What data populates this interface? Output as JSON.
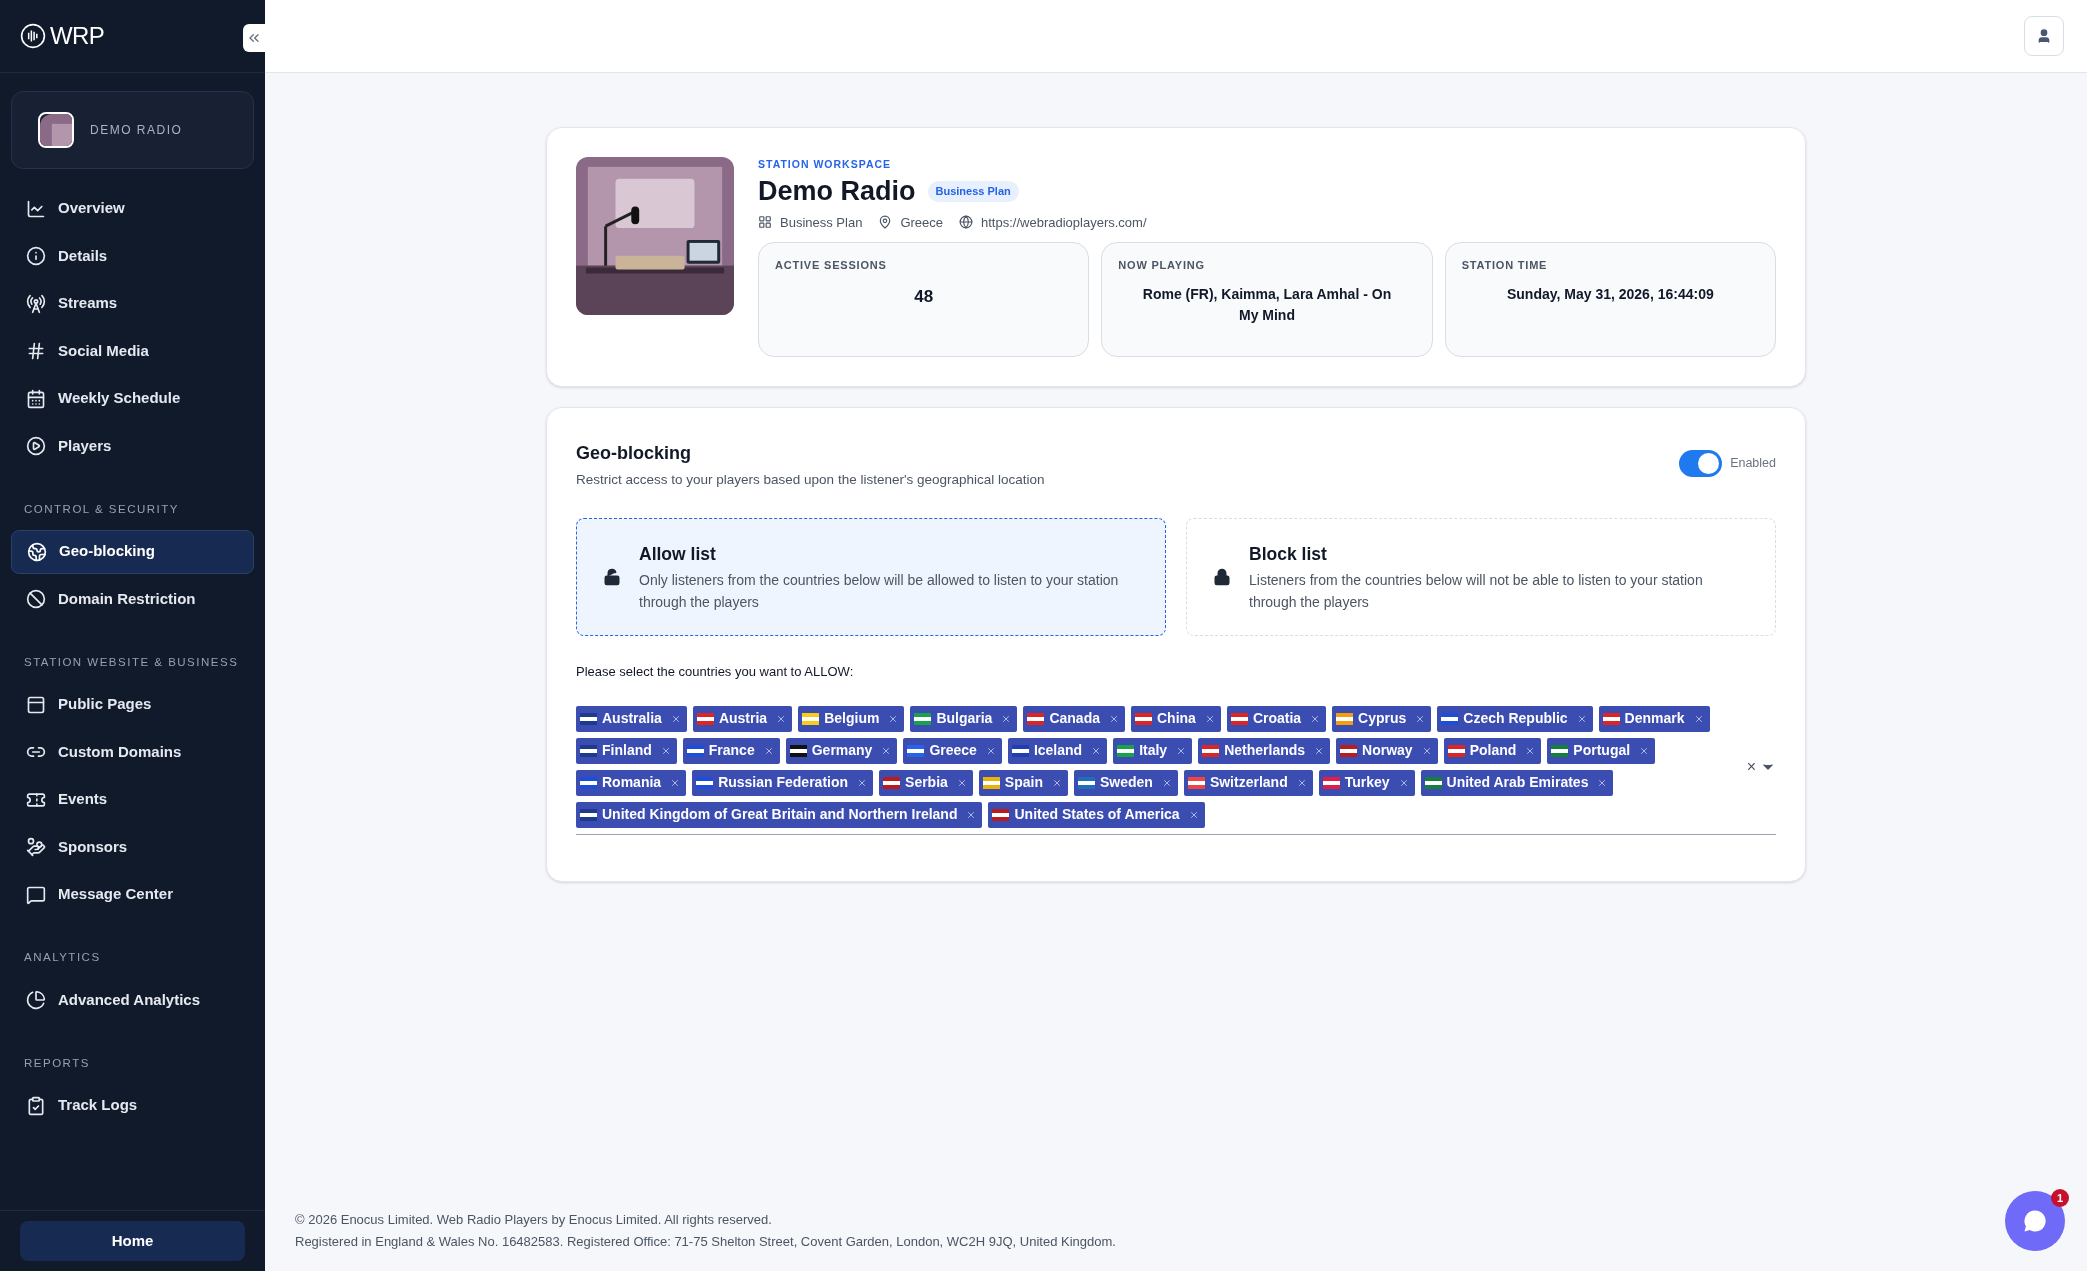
{
  "sidebar": {
    "logo": "WRP",
    "station": "DEMO RADIO",
    "sections": [
      {
        "items": [
          {
            "label": "Overview",
            "selected": false
          },
          {
            "label": "Details",
            "selected": false
          },
          {
            "label": "Streams",
            "selected": false
          },
          {
            "label": "Social Media",
            "selected": false
          },
          {
            "label": "Weekly Schedule",
            "selected": false
          },
          {
            "label": "Players",
            "selected": false
          }
        ]
      },
      {
        "title": "CONTROL & SECURITY",
        "items": [
          {
            "label": "Geo-blocking",
            "selected": true
          },
          {
            "label": "Domain Restriction",
            "selected": false
          }
        ]
      },
      {
        "title": "STATION WEBSITE & BUSINESS",
        "items": [
          {
            "label": "Public Pages",
            "selected": false
          },
          {
            "label": "Custom Domains",
            "selected": false
          },
          {
            "label": "Events",
            "selected": false
          },
          {
            "label": "Sponsors",
            "selected": false
          },
          {
            "label": "Message Center",
            "selected": false
          }
        ]
      },
      {
        "title": "ANALYTICS",
        "items": [
          {
            "label": "Advanced Analytics",
            "selected": false
          }
        ]
      },
      {
        "title": "REPORTS",
        "items": [
          {
            "label": "Track Logs",
            "selected": false
          }
        ]
      }
    ],
    "home_button": "Home"
  },
  "station": {
    "eyebrow": "STATION WORKSPACE",
    "name": "Demo Radio",
    "plan_badge": "Business Plan",
    "meta": [
      "Business Plan",
      "Greece",
      "https://webradioplayers.com/"
    ],
    "stats": [
      {
        "label": "ACTIVE SESSIONS",
        "value": "48"
      },
      {
        "label": "NOW PLAYING",
        "value": "Rome (FR), Kaimma, Lara Amhal - On My Mind"
      },
      {
        "label": "STATION TIME",
        "value": "Sunday, May 31, 2026, 16:44:09"
      }
    ]
  },
  "geo": {
    "title": "Geo-blocking",
    "subtitle": "Restrict access to your players based upon the listener's geographical location",
    "toggle": {
      "on": true,
      "label": "Enabled"
    },
    "modes": [
      {
        "title": "Allow list",
        "text": "Only listeners from the countries below will be allowed to listen to your station through the players",
        "selected": true,
        "locked": false
      },
      {
        "title": "Block list",
        "text": "Listeners from the countries below will not be able to listen to your station through the players",
        "selected": false,
        "locked": true
      }
    ],
    "prompt": "Please select the countries you want to ALLOW:",
    "countries": [
      {
        "name": "Australia",
        "color": "#1e3a8a"
      },
      {
        "name": "Austria",
        "color": "#dc2626"
      },
      {
        "name": "Belgium",
        "color": "#facc15"
      },
      {
        "name": "Bulgaria",
        "color": "#16a34a"
      },
      {
        "name": "Canada",
        "color": "#dc2626"
      },
      {
        "name": "China",
        "color": "#dc2626"
      },
      {
        "name": "Croatia",
        "color": "#dc2626"
      },
      {
        "name": "Cyprus",
        "color": "#f59e0b"
      },
      {
        "name": "Czech Republic",
        "color": "#1d4ed8"
      },
      {
        "name": "Denmark",
        "color": "#dc2626"
      },
      {
        "name": "Finland",
        "color": "#1e3a8a"
      },
      {
        "name": "France",
        "color": "#1d4ed8"
      },
      {
        "name": "Germany",
        "color": "#111111"
      },
      {
        "name": "Greece",
        "color": "#2563eb"
      },
      {
        "name": "Iceland",
        "color": "#1e40af"
      },
      {
        "name": "Italy",
        "color": "#16a34a"
      },
      {
        "name": "Netherlands",
        "color": "#dc2626"
      },
      {
        "name": "Norway",
        "color": "#b91c1c"
      },
      {
        "name": "Poland",
        "color": "#dc2626"
      },
      {
        "name": "Portugal",
        "color": "#15803d"
      },
      {
        "name": "Romania",
        "color": "#1d4ed8"
      },
      {
        "name": "Russian Federation",
        "color": "#1d4ed8"
      },
      {
        "name": "Serbia",
        "color": "#b91c1c"
      },
      {
        "name": "Spain",
        "color": "#eab308"
      },
      {
        "name": "Sweden",
        "color": "#1d6fb8"
      },
      {
        "name": "Switzerland",
        "color": "#ef4444"
      },
      {
        "name": "Turkey",
        "color": "#e11d48"
      },
      {
        "name": "United Arab Emirates",
        "color": "#15803d"
      },
      {
        "name": "United Kingdom of Great Britain and Northern Ireland",
        "color": "#1e3a8a"
      },
      {
        "name": "United States of America",
        "color": "#b91c1c"
      }
    ],
    "clear": "×"
  },
  "footer": [
    "© 2026 Enocus Limited. Web Radio Players by Enocus Limited. All rights reserved.",
    "Registered in England & Wales No. 16482583. Registered Office: 71-75 Shelton Street, Covent Garden, London, WC2H 9JQ, United Kingdom."
  ],
  "chat": {
    "badge": "1"
  }
}
